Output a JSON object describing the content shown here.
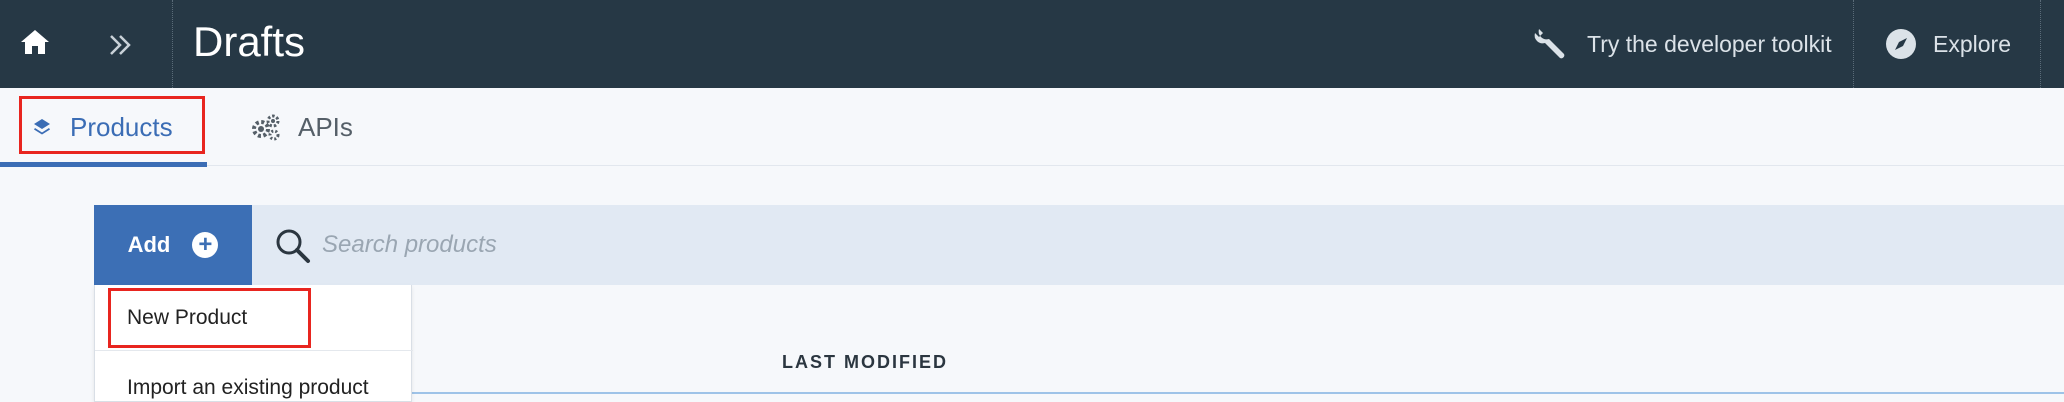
{
  "header": {
    "title": "Drafts",
    "toolkit_label": "Try the developer toolkit",
    "explore_label": "Explore",
    "icons": {
      "home": "home-icon",
      "expand": "double-chevron-right-icon",
      "toolkit": "wrench-icon",
      "explore": "compass-icon"
    }
  },
  "tabs": {
    "products": {
      "label": "Products",
      "icon": "layers-icon",
      "selected": true
    },
    "apis": {
      "label": "APIs",
      "icon": "gears-icon",
      "selected": false
    }
  },
  "toolbar": {
    "add_label": "Add",
    "search_placeholder": "Search products"
  },
  "add_menu": {
    "items": [
      {
        "label": "New Product"
      },
      {
        "label": "Import an existing product"
      }
    ]
  },
  "table": {
    "columns": [
      "LAST MODIFIED"
    ]
  },
  "colors": {
    "header_bg": "#263845",
    "accent": "#3c6fb5",
    "highlight": "#e8251f",
    "toolbar_bg": "#e1e9f3"
  }
}
